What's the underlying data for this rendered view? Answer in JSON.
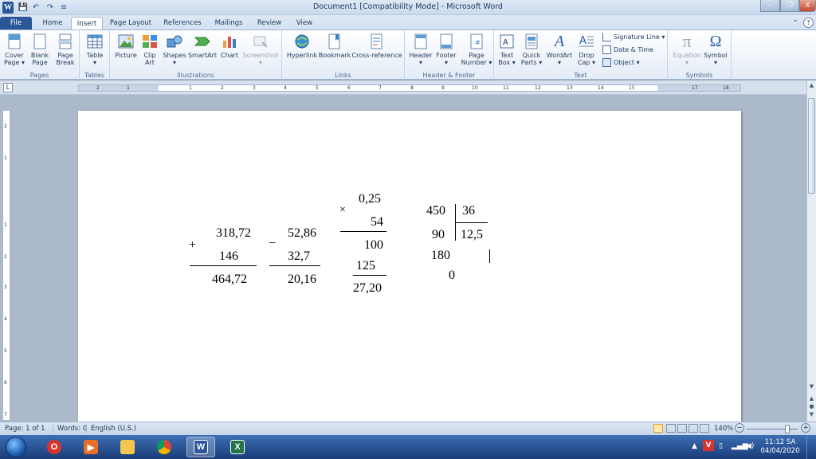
{
  "window": {
    "title": "Document1 [Compatibility Mode]  -  Microsoft Word",
    "app_letter": "W",
    "qa_save": "💾",
    "qa_undo": "↶",
    "qa_redo": "↷",
    "qa_customize": "≡",
    "minimize": "–",
    "restore": "❐",
    "close": "X",
    "help": "?",
    "minimize_ribbon": "⌃"
  },
  "tabs": [
    "File",
    "Home",
    "Insert",
    "Page Layout",
    "References",
    "Mailings",
    "Review",
    "View"
  ],
  "ribbon": {
    "pages": {
      "label": "Pages",
      "cover": "Cover\nPage ▾",
      "blank": "Blank\nPage",
      "break": "Page\nBreak"
    },
    "tables": {
      "label": "Tables",
      "table": "Table\n▾"
    },
    "illustrations": {
      "label": "Illustrations",
      "picture": "Picture",
      "clipart": "Clip\nArt",
      "shapes": "Shapes\n▾",
      "smartart": "SmartArt",
      "chart": "Chart",
      "screenshot": "Screenshot\n▾"
    },
    "links": {
      "label": "Links",
      "hyperlink": "Hyperlink",
      "bookmark": "Bookmark",
      "crossref": "Cross-reference"
    },
    "headerfooter": {
      "label": "Header & Footer",
      "header": "Header\n▾",
      "footer": "Footer\n▾",
      "pagenumber": "Page\nNumber ▾"
    },
    "text": {
      "label": "Text",
      "textbox": "Text\nBox ▾",
      "quickparts": "Quick\nParts ▾",
      "wordart": "WordArt\n▾",
      "dropcap": "Drop\nCap ▾",
      "signature": "Signature Line ▾",
      "datetime": "Date & Time",
      "object": "Object ▾"
    },
    "symbols": {
      "label": "Symbols",
      "equation": "Equation\n▾",
      "symbol": "Symbol\n▾"
    }
  },
  "ruler": {
    "corner": "L",
    "ticks": [
      "2",
      "1",
      "1",
      "2",
      "3",
      "4",
      "5",
      "6",
      "7",
      "8",
      "9",
      "10",
      "11",
      "12",
      "13",
      "14",
      "15",
      "17",
      "18"
    ],
    "vticks": [
      "2",
      "1",
      "1",
      "2",
      "3",
      "4",
      "5",
      "6",
      "7"
    ]
  },
  "document": {
    "addition": {
      "sign": "+",
      "a": "318,72",
      "b": "146",
      "result": "464,72"
    },
    "subtraction": {
      "sign": "−",
      "a": "52,86",
      "b": "32,7",
      "result": "20,16"
    },
    "multiplication": {
      "sign": "×",
      "a": "0,25",
      "b": "54",
      "partial1": "100",
      "partial2": "125",
      "result": "27,20"
    },
    "division": {
      "dividend": "450",
      "divisor": "36",
      "quotient": "12,5",
      "rem1": "90",
      "rem2": "180",
      "rem3": "0"
    }
  },
  "status": {
    "page": "Page: 1 of 1",
    "words": "Words: 0",
    "language": "English (U.S.)",
    "zoom": "140%",
    "zoom_out": "−",
    "zoom_in": "+"
  },
  "taskbar": {
    "clock_time": "11:12 SA",
    "clock_date": "04/04/2020",
    "word_letter": "W",
    "excel_letter": "X",
    "tray_lang": "V"
  }
}
